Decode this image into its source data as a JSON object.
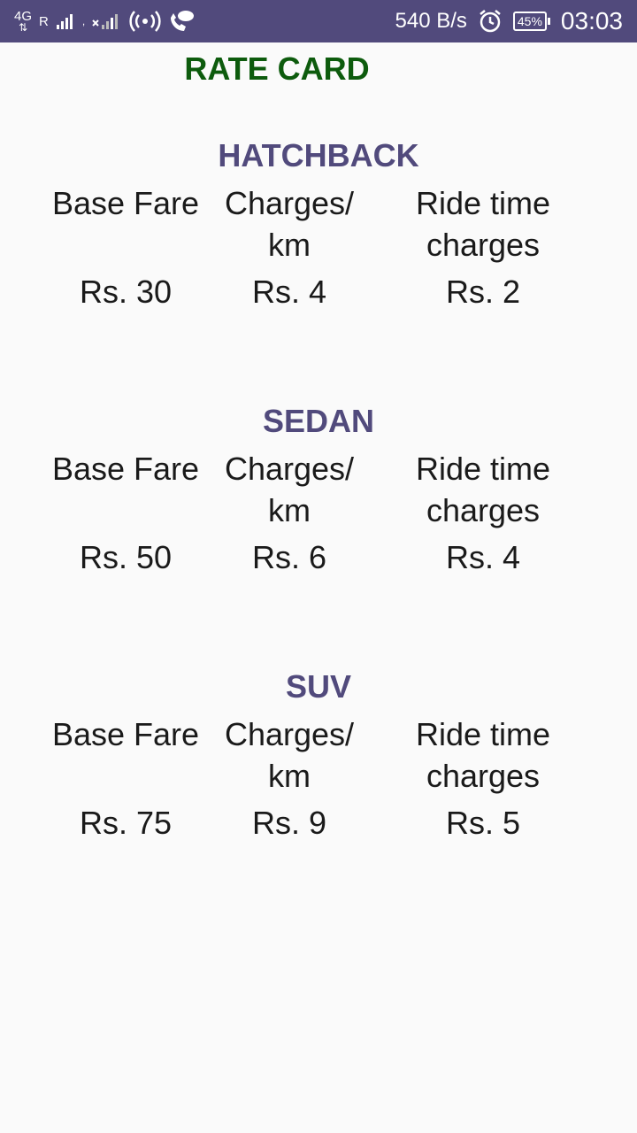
{
  "status_bar": {
    "network_type": "4G",
    "sim1_indicator": "R",
    "speed": "540 B/s",
    "battery": "45%",
    "time": "03:03",
    "icons": [
      "signal-sim1-icon",
      "signal-sim2-icon",
      "hotspot-icon",
      "wifi-calling-icon",
      "alarm-icon",
      "battery-icon"
    ]
  },
  "title": "RATE CARD",
  "sections": [
    {
      "name": "HATCHBACK",
      "headers": [
        "Base Fare",
        "Charges/ km",
        "Ride time charges"
      ],
      "values": [
        "Rs. 30",
        "Rs. 4",
        "Rs. 2"
      ]
    },
    {
      "name": "SEDAN",
      "headers": [
        "Base Fare",
        "Charges/ km",
        "Ride time charges"
      ],
      "values": [
        "Rs. 50",
        "Rs. 6",
        "Rs. 4"
      ]
    },
    {
      "name": "SUV",
      "headers": [
        "Base Fare",
        "Charges/ km",
        "Ride time charges"
      ],
      "values": [
        "Rs. 75",
        "Rs. 9",
        "Rs. 5"
      ]
    }
  ],
  "colors": {
    "status_bar": "#514a7c",
    "title": "#0d5b0d",
    "section_title": "#514a7c",
    "text": "#1a1a1a",
    "background": "#fafafa"
  }
}
